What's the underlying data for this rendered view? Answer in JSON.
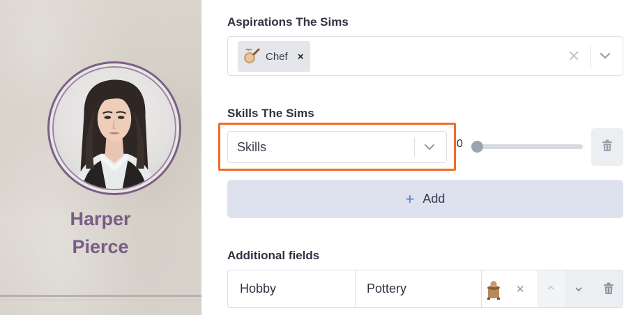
{
  "profile": {
    "name": "Harper Pierce"
  },
  "aspirations": {
    "label": "Aspirations The Sims",
    "selected": [
      {
        "label": "Chef",
        "icon": "chef-pan-icon"
      }
    ],
    "remove_glyph": "×",
    "clear_glyph": "✕"
  },
  "skills": {
    "label": "Skills The Sims",
    "select_value": "Skills",
    "level_value": "0",
    "level_fraction": 0
  },
  "add_button": {
    "plus": "+",
    "label": "Add"
  },
  "additional_fields": {
    "label": "Additional fields",
    "rows": [
      {
        "key": "Hobby",
        "value": "Pottery",
        "icon": "pottery-wheel-icon",
        "clear_glyph": "✕"
      }
    ]
  },
  "colors": {
    "accent_highlight": "#f26a22",
    "name_color": "#7a5b86",
    "add_plus": "#4f7bd8"
  }
}
